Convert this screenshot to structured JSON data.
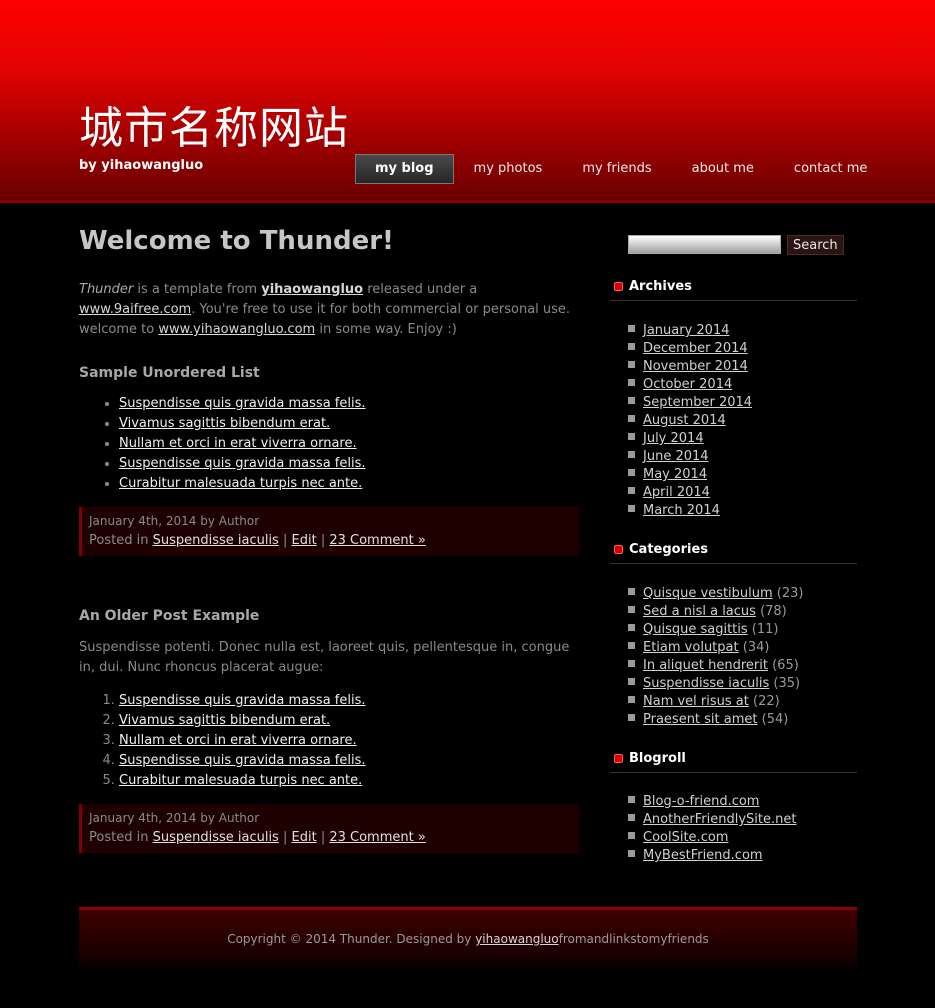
{
  "header": {
    "title": "城市名称网站",
    "subtitle": "by yihaowangluo",
    "nav": [
      "my blog",
      "my photos",
      "my friends",
      "about me",
      "contact me"
    ]
  },
  "post1": {
    "title": "Welcome to Thunder!",
    "intro": {
      "name": "Thunder",
      "t1": " is a template from ",
      "link1": "yihaowangluo",
      "t2": " released under a ",
      "link2": "www.9aifree.com",
      "t3": ". You're free to use it for both commercial or personal use. welcome to ",
      "link3": "www.yihaowangluo.com",
      "t4": " in some way. Enjoy :)"
    },
    "subheading": "Sample Unordered List",
    "list": [
      "Suspendisse quis gravida massa felis.",
      "Vivamus sagittis bibendum erat.",
      "Nullam et orci in erat viverra ornare.",
      "Suspendisse quis gravida massa felis.",
      "Curabitur malesuada turpis nec ante."
    ],
    "meta": {
      "date": "January 4th, 2014 by Author",
      "posted_in": "Posted in ",
      "category": "Suspendisse iaculis",
      "sep": " | ",
      "edit": "Edit",
      "comments": "23 Comment »"
    }
  },
  "post2": {
    "title": "An Older Post Example",
    "body": "Suspendisse potenti. Donec nulla est, laoreet quis, pellentesque in, congue in, dui. Nunc rhoncus placerat augue:",
    "list": [
      "Suspendisse quis gravida massa felis.",
      "Vivamus sagittis bibendum erat.",
      "Nullam et orci in erat viverra ornare.",
      "Suspendisse quis gravida massa felis.",
      "Curabitur malesuada turpis nec ante."
    ],
    "meta": {
      "date": "January 4th, 2014 by Author",
      "posted_in": "Posted in ",
      "category": "Suspendisse iaculis",
      "sep": " | ",
      "edit": "Edit",
      "comments": "23 Comment »"
    }
  },
  "sidebar": {
    "search_button": "Search",
    "archives": {
      "title": "Archives",
      "items": [
        "January 2014",
        "December 2014",
        "November 2014",
        "October 2014",
        "September 2014",
        "August 2014",
        "July 2014",
        "June 2014",
        "May 2014",
        "April 2014",
        "March 2014"
      ]
    },
    "categories": {
      "title": "Categories",
      "items": [
        {
          "label": "Quisque vestibulum",
          "count": " (23)"
        },
        {
          "label": "Sed a nisl a lacus",
          "count": " (78)"
        },
        {
          "label": "Quisque sagittis",
          "count": " (11)"
        },
        {
          "label": "Etiam volutpat",
          "count": " (34)"
        },
        {
          "label": "In aliquet hendrerit",
          "count": " (65)"
        },
        {
          "label": "Suspendisse iaculis",
          "count": " (35)"
        },
        {
          "label": "Nam vel risus at",
          "count": " (22)"
        },
        {
          "label": "Praesent sit amet",
          "count": " (54)"
        }
      ]
    },
    "blogroll": {
      "title": "Blogroll",
      "items": [
        "Blog-o-friend.com",
        "AnotherFriendlySite.net",
        "CoolSite.com",
        "MyBestFriend.com"
      ]
    }
  },
  "footer": {
    "text": "Copyright © 2014 Thunder. Designed by ",
    "link": "yihaowangluo",
    "tail": "fromandlinkstomyfriends"
  }
}
